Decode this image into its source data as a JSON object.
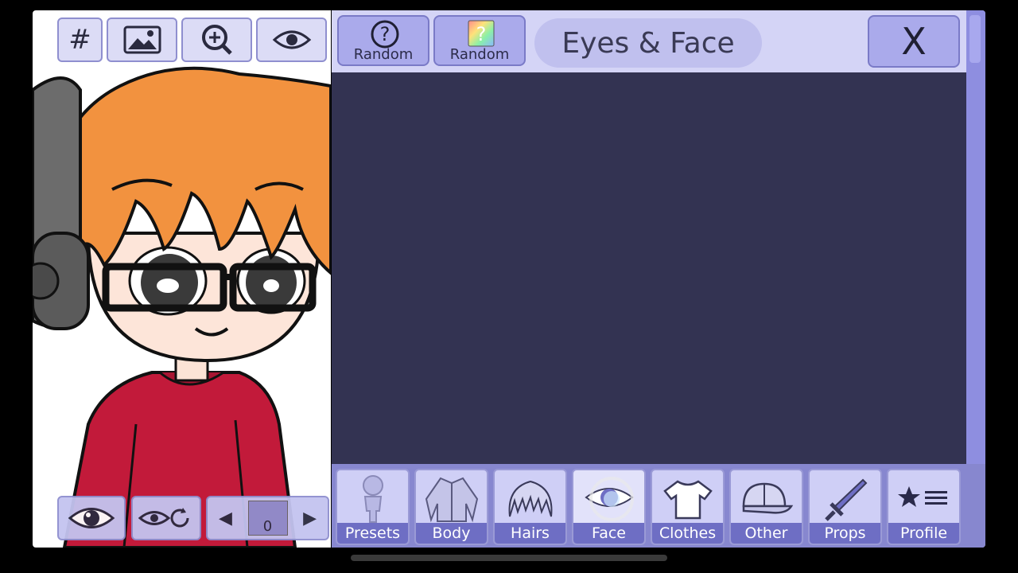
{
  "preview": {
    "buttons": [
      {
        "icon": "hash-icon",
        "label": "#"
      },
      {
        "icon": "image-icon"
      },
      {
        "icon": "zoom-in-icon"
      },
      {
        "icon": "eye-icon"
      }
    ],
    "bottom_buttons": [
      {
        "icon": "eye-icon"
      },
      {
        "icon": "eye-reset-icon"
      },
      {
        "icon": "layer-selector",
        "value": "0"
      }
    ]
  },
  "panel": {
    "random_buttons": [
      {
        "icon": "question-circle-icon",
        "label": "Random"
      },
      {
        "icon": "rainbow-question-icon",
        "label": "Random"
      }
    ],
    "title": "Eyes & Face",
    "close_label": "X",
    "categories": [
      {
        "icon": "silhouette-icon",
        "label": "Presets"
      },
      {
        "icon": "jacket-icon",
        "label": "Body"
      },
      {
        "icon": "hair-icon",
        "label": "Hairs"
      },
      {
        "icon": "eye-icon",
        "label": "Face",
        "active": true
      },
      {
        "icon": "shirt-icon",
        "label": "Clothes"
      },
      {
        "icon": "cap-icon",
        "label": "Other"
      },
      {
        "icon": "sword-icon",
        "label": "Props"
      },
      {
        "icon": "star-list-icon",
        "label": "Profile"
      }
    ]
  },
  "colors": {
    "panel_bg": "#ccccf2",
    "content_bg": "#333352",
    "category_bar": "#8787cf",
    "hair": "#f2923f",
    "hoodie": "#c21a3a"
  }
}
